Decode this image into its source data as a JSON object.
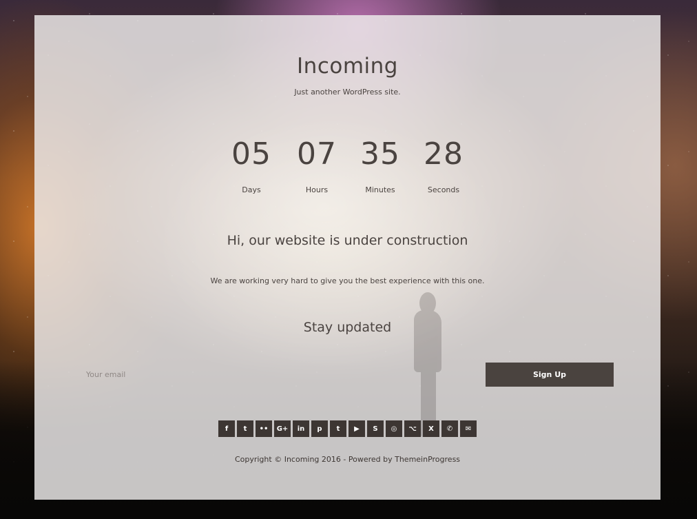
{
  "site": {
    "title": "Incoming",
    "tagline": "Just another WordPress site."
  },
  "countdown": {
    "days": {
      "value": "05",
      "label": "Days"
    },
    "hours": {
      "value": "07",
      "label": "Hours"
    },
    "minutes": {
      "value": "35",
      "label": "Minutes"
    },
    "seconds": {
      "value": "28",
      "label": "Seconds"
    }
  },
  "content": {
    "headline": "Hi, our website is under construction",
    "subtext": "We are working very hard to give you the best experience with this one.",
    "stay_updated": "Stay updated"
  },
  "newsletter": {
    "email_placeholder": "Your email",
    "email_value": "",
    "signup_label": "Sign Up"
  },
  "social": [
    {
      "name": "facebook-icon",
      "glyph": "f"
    },
    {
      "name": "twitter-icon",
      "glyph": "t"
    },
    {
      "name": "flickr-icon",
      "glyph": "••"
    },
    {
      "name": "google-plus-icon",
      "glyph": "G+"
    },
    {
      "name": "linkedin-icon",
      "glyph": "in"
    },
    {
      "name": "pinterest-icon",
      "glyph": "p"
    },
    {
      "name": "tumblr-icon",
      "glyph": "t"
    },
    {
      "name": "youtube-icon",
      "glyph": "▶"
    },
    {
      "name": "skype-icon",
      "glyph": "S"
    },
    {
      "name": "instagram-icon",
      "glyph": "◎"
    },
    {
      "name": "github-icon",
      "glyph": "⌥"
    },
    {
      "name": "xing-icon",
      "glyph": "X"
    },
    {
      "name": "whatsapp-icon",
      "glyph": "✆"
    },
    {
      "name": "email-icon",
      "glyph": "✉"
    }
  ],
  "footer": {
    "copyright": "Copyright © Incoming 2016 - Powered by ThemeinProgress"
  },
  "colors": {
    "text": "#4a4340",
    "button_bg": "#4a433f",
    "icon_bg": "#3d3633",
    "panel_bg": "#ecebeb"
  }
}
